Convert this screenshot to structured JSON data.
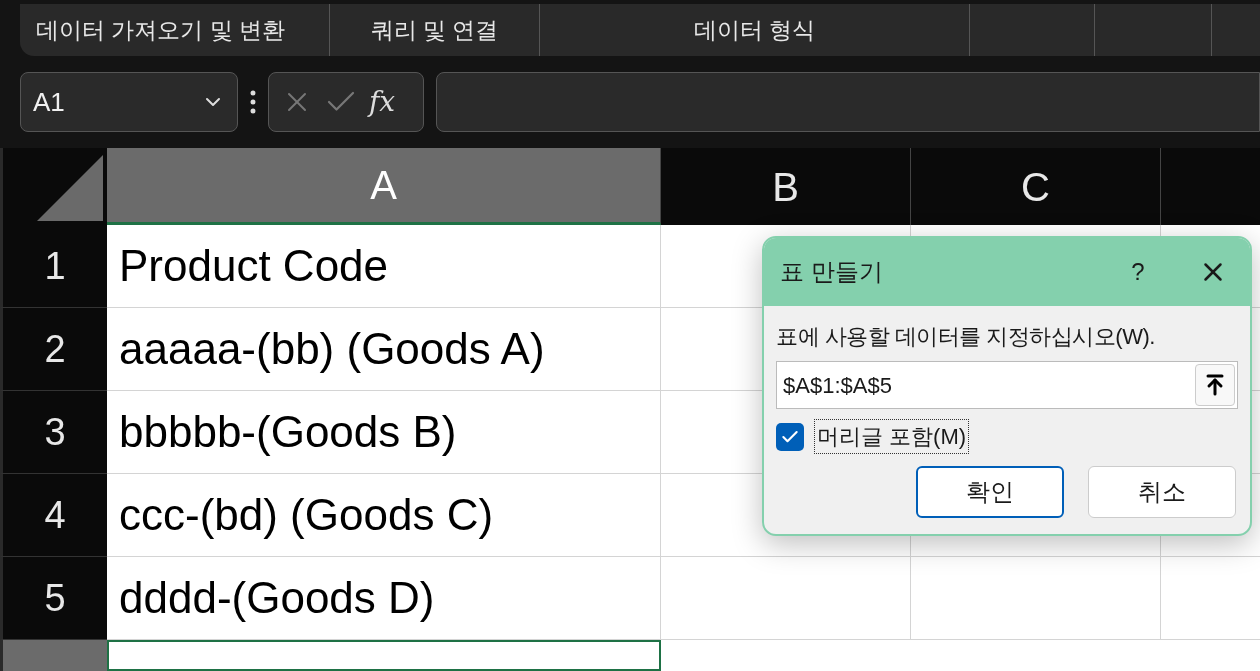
{
  "ribbon_groups": [
    {
      "label": "데이터 가져오기 및 변환"
    },
    {
      "label": "쿼리 및 연결"
    },
    {
      "label": "데이터 형식"
    }
  ],
  "name_box": {
    "value": "A1"
  },
  "formula_bar": {
    "fx": "fx"
  },
  "columns": [
    {
      "label": "A",
      "selected": true
    },
    {
      "label": "B",
      "selected": false
    },
    {
      "label": "C",
      "selected": false
    }
  ],
  "rows": [
    {
      "number": "1",
      "cells": [
        "Product Code"
      ]
    },
    {
      "number": "2",
      "cells": [
        "aaaaa-(bb) (Goods A)"
      ]
    },
    {
      "number": "3",
      "cells": [
        "bbbbb-(Goods B)"
      ]
    },
    {
      "number": "4",
      "cells": [
        "ccc-(bd) (Goods C)"
      ]
    },
    {
      "number": "5",
      "cells": [
        "dddd-(Goods D)"
      ]
    }
  ],
  "dialog": {
    "title": "표 만들기",
    "help": "?",
    "prompt": "표에 사용할 데이터를 지정하십시오(W).",
    "range": "$A$1:$A$5",
    "header_checkbox": {
      "label": "머리글 포함(M)",
      "checked": true
    },
    "buttons": [
      {
        "label": "확인",
        "default": true
      },
      {
        "label": "취소",
        "default": false
      }
    ]
  }
}
